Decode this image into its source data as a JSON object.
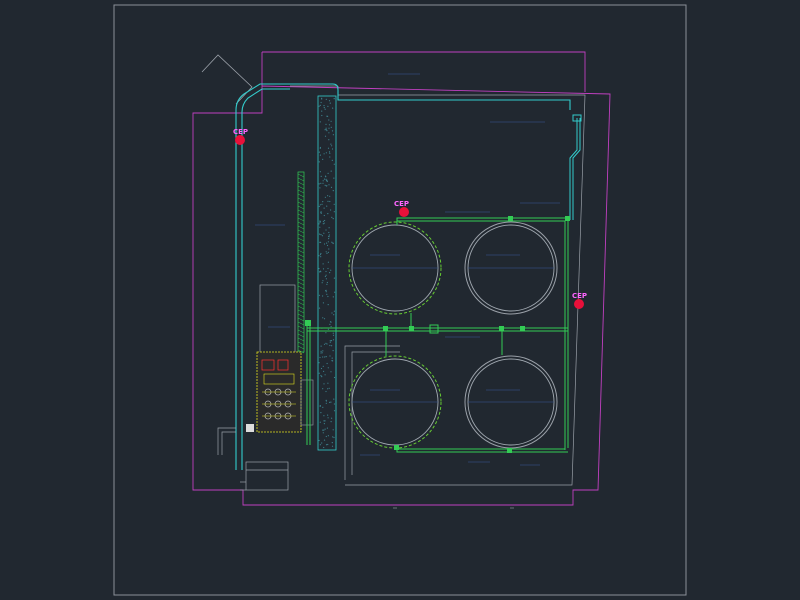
{
  "drawing": {
    "background_color": "#212830",
    "frame_color": "#8a9099",
    "site_boundary_color": "#c040c0",
    "pipe_color_cyan": "#33cccc",
    "pipe_color_green": "#33cc55",
    "annotation_color": "#3a5a9c",
    "marker_color": "#e8103a",
    "tank_dashed_color": "#66cc33",
    "tank_solid_color": "#a0a8b0"
  },
  "markers": [
    {
      "label": "CEP"
    },
    {
      "label": "CEP"
    },
    {
      "label": "CEP"
    }
  ],
  "tanks": [
    {
      "id": "tank-top-left"
    },
    {
      "id": "tank-top-right"
    },
    {
      "id": "tank-bottom-left"
    },
    {
      "id": "tank-bottom-right"
    }
  ]
}
